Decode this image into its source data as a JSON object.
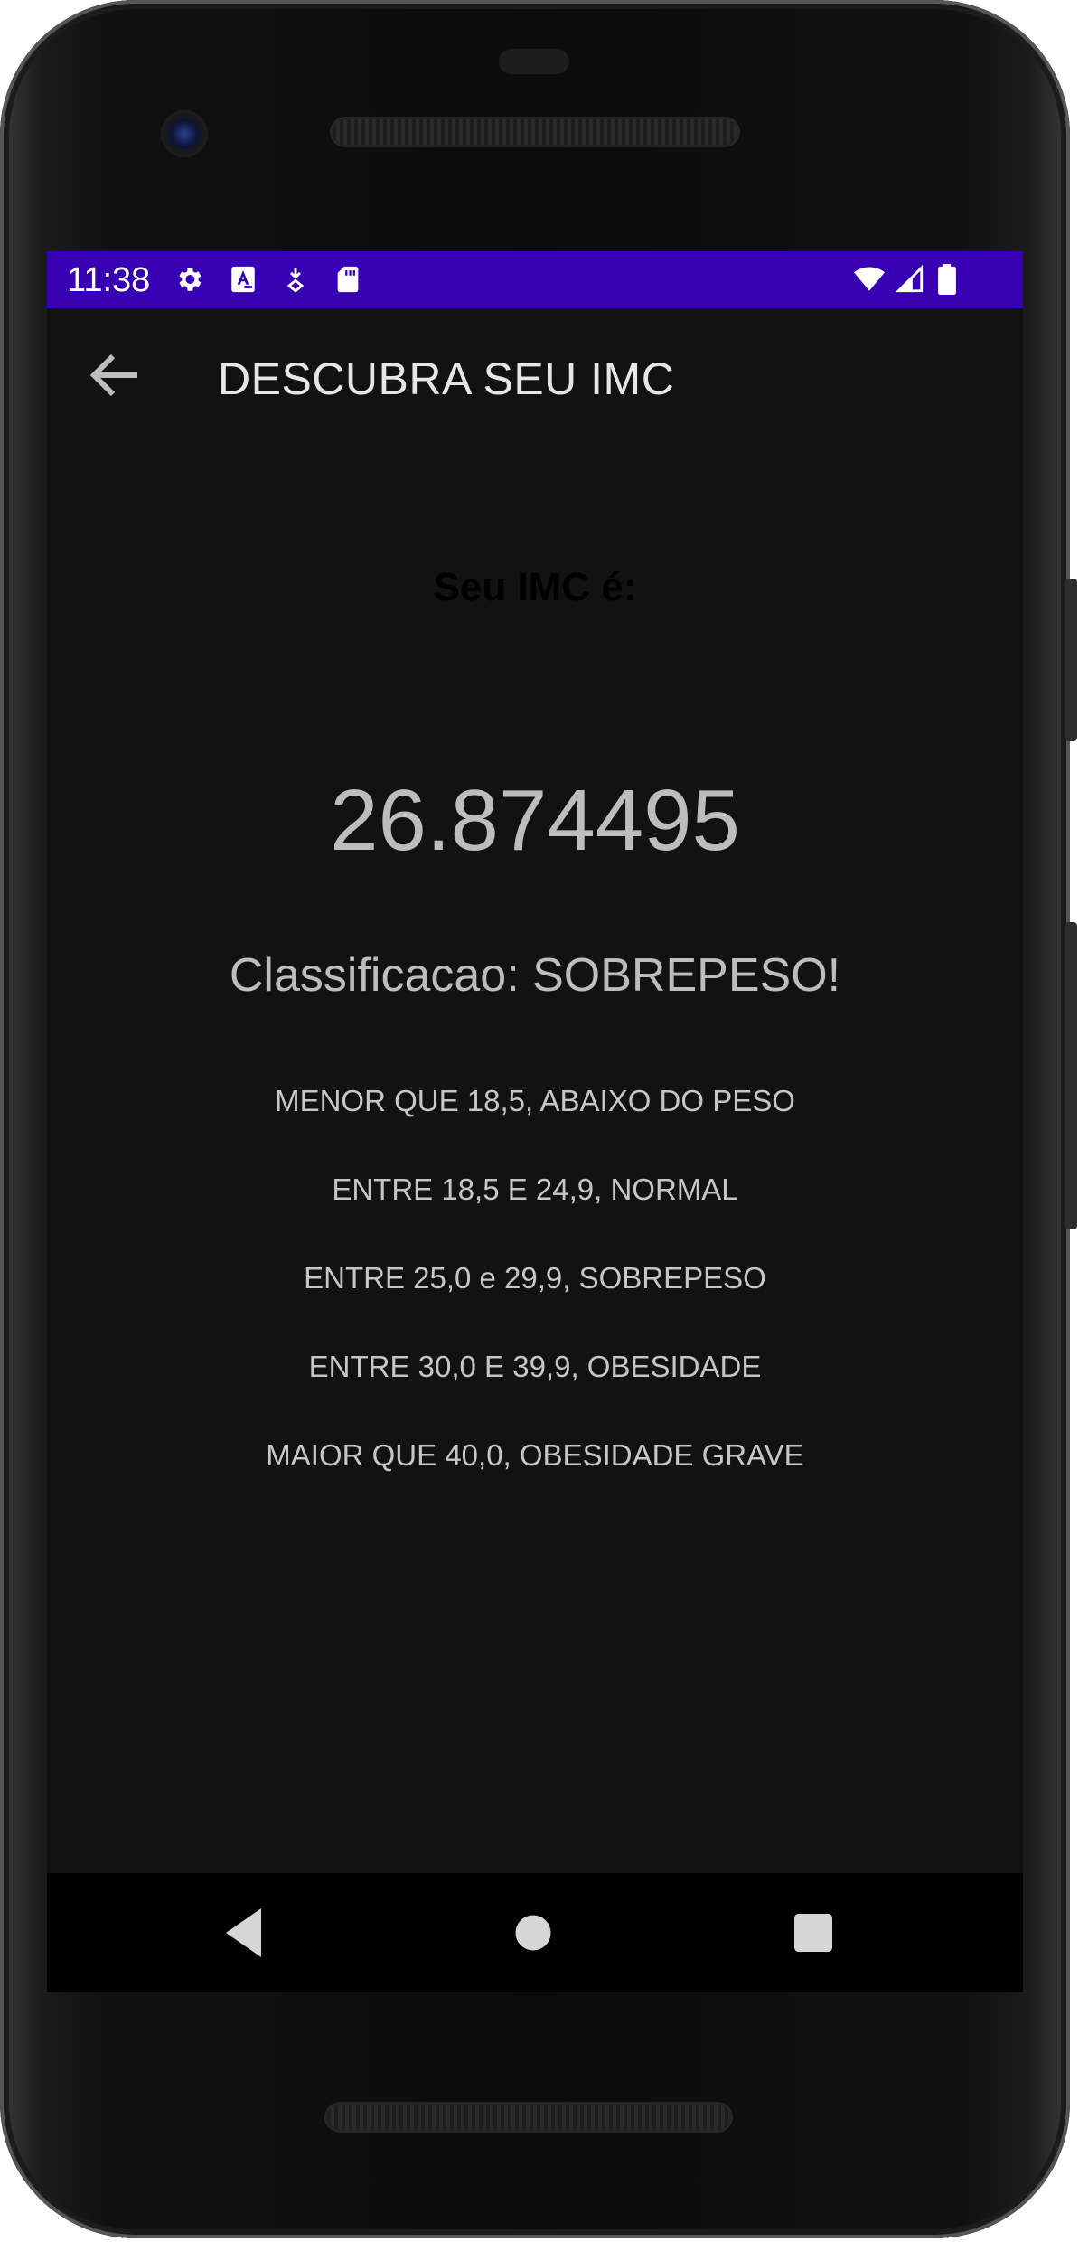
{
  "status_bar": {
    "time": "11:38",
    "left_icons": [
      "settings-icon",
      "keyboard-a-icon",
      "download-icon",
      "sd-card-icon"
    ],
    "right_icons": [
      "wifi-icon",
      "signal-icon",
      "battery-icon"
    ],
    "background_color": "#3700b3"
  },
  "app_bar": {
    "title": "DESCUBRA SEU IMC",
    "back_icon": "arrow-back-icon"
  },
  "result": {
    "label": "Seu IMC é:",
    "value": "26.874495",
    "classification": "Classificacao: SOBREPESO!"
  },
  "ranges": [
    "MENOR QUE 18,5, ABAIXO DO PESO",
    "ENTRE 18,5 E 24,9, NORMAL",
    "ENTRE 25,0 e 29,9, SOBREPESO",
    "ENTRE 30,0 E 39,9, OBESIDADE",
    "MAIOR QUE 40,0, OBESIDADE GRAVE"
  ],
  "nav_bar": {
    "icons": [
      "back-triangle-icon",
      "home-circle-icon",
      "recents-square-icon"
    ]
  },
  "colors": {
    "screen_background": "#121212",
    "accent": "#3700b3",
    "text_secondary": "#bdbdbd"
  }
}
